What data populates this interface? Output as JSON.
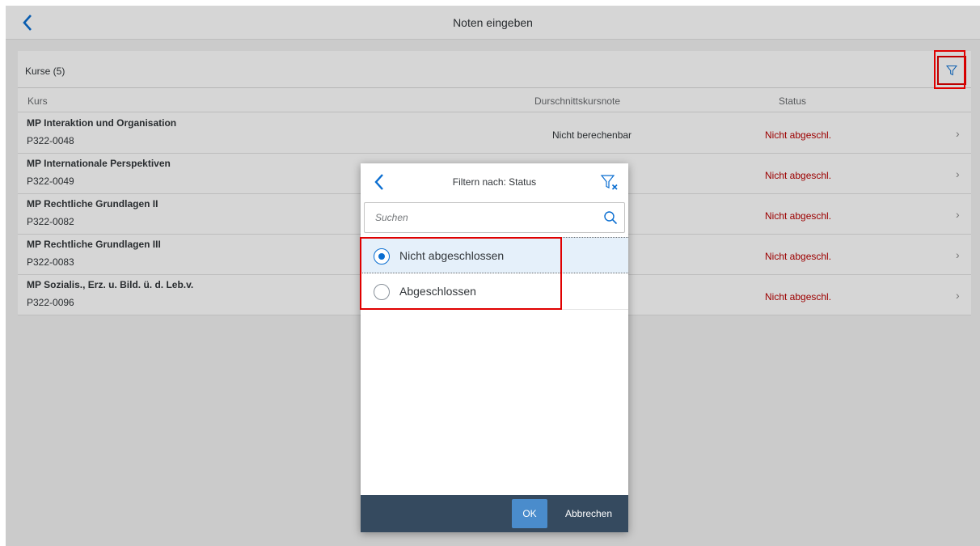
{
  "shell": {
    "title": "Noten eingeben"
  },
  "list": {
    "count_label": "Kurse (5)",
    "columns": {
      "kurs": "Kurs",
      "note": "Durschnittskursnote",
      "status": "Status"
    },
    "rows": [
      {
        "name": "MP Interaktion und Organisation",
        "code": "P322-0048",
        "note": "Nicht berechenbar",
        "status": "Nicht abgeschl."
      },
      {
        "name": "MP Internationale Perspektiven",
        "code": "P322-0049",
        "note": "",
        "status": "Nicht abgeschl."
      },
      {
        "name": "MP Rechtliche Grundlagen II",
        "code": "P322-0082",
        "note": "",
        "status": "Nicht abgeschl."
      },
      {
        "name": "MP Rechtliche Grundlagen III",
        "code": "P322-0083",
        "note": "",
        "status": "Nicht abgeschl."
      },
      {
        "name": "MP Sozialis., Erz. u. Bild. ü. d. Leb.v.",
        "code": "P322-0096",
        "note": "",
        "status": "Nicht abgeschl."
      }
    ]
  },
  "dialog": {
    "title": "Filtern nach: Status",
    "search": {
      "placeholder": "Suchen",
      "value": ""
    },
    "options": [
      {
        "label": "Nicht abgeschlossen",
        "selected": true
      },
      {
        "label": "Abgeschlossen",
        "selected": false
      }
    ],
    "ok_label": "OK",
    "cancel_label": "Abbrechen"
  },
  "colors": {
    "accent": "#0a6ed1",
    "status_negative": "#bb0000",
    "footer": "#354a5f",
    "highlight": "#e00000"
  },
  "icons": {
    "back": "chevron-left-icon",
    "filter": "filter-icon",
    "clear_filter": "clear-filter-icon",
    "search": "search-icon",
    "row_nav": "chevron-right-icon"
  }
}
